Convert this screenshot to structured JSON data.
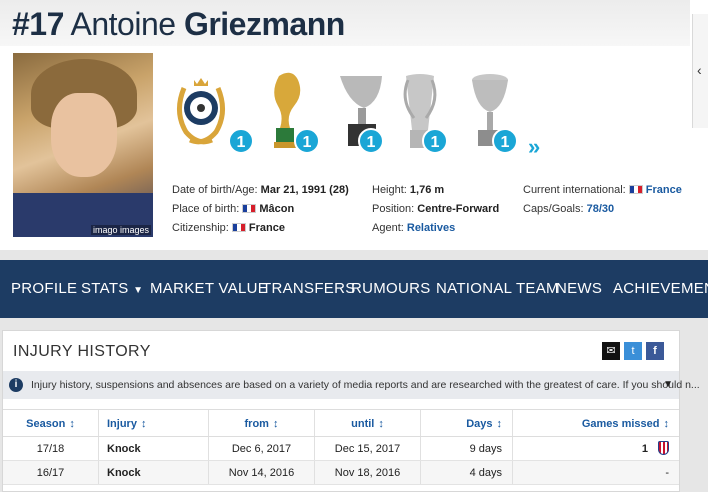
{
  "player": {
    "number": "#17",
    "first_name": "Antoine",
    "last_name": "Griezmann",
    "photo_credit": "imago images"
  },
  "trophies": [
    {
      "icon": "laurel-ball-icon",
      "count": "1"
    },
    {
      "icon": "world-cup-icon",
      "count": "1"
    },
    {
      "icon": "super-cup-icon",
      "count": "1"
    },
    {
      "icon": "europa-league-icon",
      "count": "1"
    },
    {
      "icon": "uefa-super-cup-icon",
      "count": "1"
    }
  ],
  "info": {
    "dob_label": "Date of birth/Age:",
    "dob_value": "Mar 21, 1991 (28)",
    "pob_label": "Place of birth:",
    "pob_value": "Mâcon",
    "citizenship_label": "Citizenship:",
    "citizenship_value": "France",
    "height_label": "Height:",
    "height_value": "1,76 m",
    "position_label": "Position:",
    "position_value": "Centre-Forward",
    "agent_label": "Agent:",
    "agent_value": "Relatives",
    "intl_label": "Current international:",
    "intl_value": "France",
    "caps_label": "Caps/Goals:",
    "caps_value": "78/30"
  },
  "nav": [
    "PROFILE",
    "STATS",
    "MARKET VALUE",
    "TRANSFERS",
    "RUMOURS",
    "NATIONAL TEAM",
    "NEWS",
    "ACHIEVEMENTS"
  ],
  "panel": {
    "title": "INJURY HISTORY",
    "notice": "Injury history, suspensions and absences are based on a variety of media reports and are researched with the greatest of care. If you should n..."
  },
  "table": {
    "headers": [
      "Season",
      "Injury",
      "from",
      "until",
      "Days",
      "Games missed"
    ],
    "rows": [
      {
        "season": "17/18",
        "injury": "Knock",
        "from": "Dec 6, 2017",
        "until": "Dec 15, 2017",
        "days": "9 days",
        "games": "1"
      },
      {
        "season": "16/17",
        "injury": "Knock",
        "from": "Nov 14, 2016",
        "until": "Nov 18, 2016",
        "days": "4 days",
        "games": "-"
      }
    ]
  },
  "colors": {
    "nav_bg": "#1d3c63",
    "accent": "#1aa6d6",
    "link": "#1a5aa0"
  }
}
